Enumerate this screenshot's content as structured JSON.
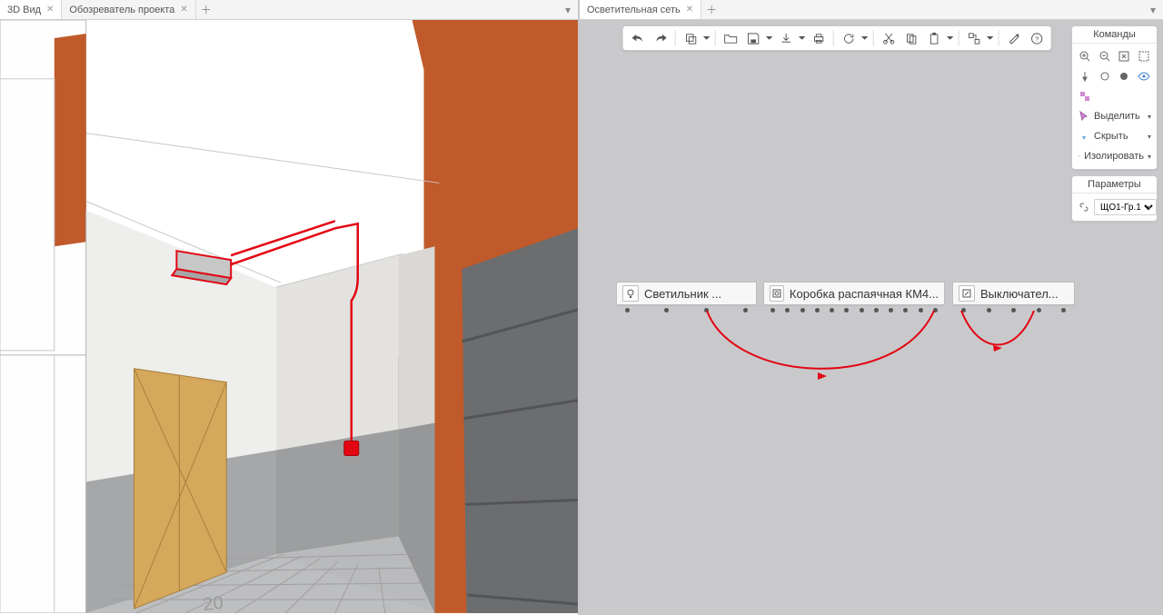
{
  "left_tabs": {
    "items": [
      {
        "label": "3D Вид"
      },
      {
        "label": "Обозреватель проекта"
      }
    ]
  },
  "right_tabs": {
    "items": [
      {
        "label": "Осветительная сеть"
      }
    ]
  },
  "toolbar": {
    "undo": "undo",
    "redo": "redo",
    "copyobj": "copy-object",
    "open": "open",
    "save": "save",
    "export": "export",
    "print": "print",
    "find": "find",
    "cut": "cut",
    "copy": "copy",
    "paste": "paste",
    "linked": "linked",
    "wrench": "settings",
    "help": "help"
  },
  "panels": {
    "commands_title": "Команды",
    "cmd_select": "Выделить",
    "cmd_hide": "Скрыть",
    "cmd_isolate": "Изолировать",
    "params_title": "Параметры",
    "param_value": "ЩО1-Гр.1"
  },
  "nodes": {
    "n1": "Светильник ...",
    "n2": "Коробка распаячная КМ4...",
    "n3": "Выключател..."
  },
  "floor_label": "20",
  "colors": {
    "wall_orange": "#c05a2a",
    "wall_grey": "#6b6d6f",
    "door": "#d6a85c",
    "base_grey": "#a6a7a8",
    "floor_tile": "#b9babb",
    "wire_red": "#e30613"
  }
}
